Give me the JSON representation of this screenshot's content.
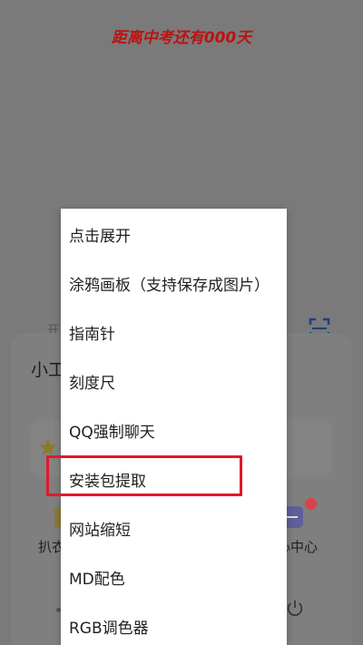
{
  "background": {
    "countdown_text": "距离中考还有000天",
    "underlay_label": "开",
    "sheet": {
      "title": "小工",
      "tool_left_label": "扒衣",
      "tool_right_label": "心中心"
    }
  },
  "popup_menu": {
    "items": [
      {
        "label": "点击展开"
      },
      {
        "label": "涂鸦画板（支持保存成图片）"
      },
      {
        "label": "指南针"
      },
      {
        "label": "刻度尺"
      },
      {
        "label": "QQ强制聊天"
      },
      {
        "label": "安装包提取"
      },
      {
        "label": "网站缩短"
      },
      {
        "label": "MD配色"
      },
      {
        "label": "RGB调色器"
      }
    ],
    "highlighted_item": "安装包提取"
  },
  "colors": {
    "countdown": "#b81414",
    "highlight": "#e0192d",
    "notify_dot": "#d9434a"
  },
  "icons": [
    "scan-icon",
    "star-icon",
    "power-icon"
  ]
}
